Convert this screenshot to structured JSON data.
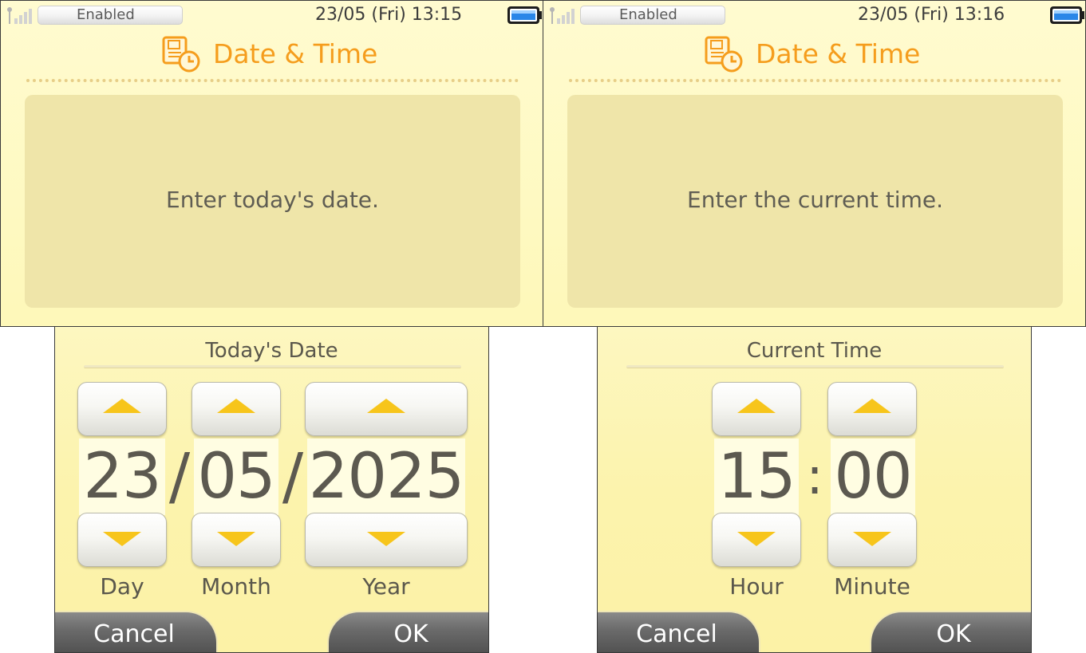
{
  "top_left": {
    "status": {
      "wireless": "Enabled",
      "datetime": "23/05 (Fri)  13:15"
    },
    "title": "Date & Time",
    "message": "Enter today's date."
  },
  "top_right": {
    "status": {
      "wireless": "Enabled",
      "datetime": "23/05 (Fri)  13:16"
    },
    "title": "Date & Time",
    "message": "Enter the current time."
  },
  "date_screen": {
    "title": "Today's Date",
    "fields": {
      "day": {
        "value": "23",
        "label": "Day"
      },
      "month": {
        "value": "05",
        "label": "Month"
      },
      "year": {
        "value": "2025",
        "label": "Year"
      }
    },
    "separator": "/",
    "cancel_label": "Cancel",
    "ok_label": "OK"
  },
  "time_screen": {
    "title": "Current Time",
    "fields": {
      "hour": {
        "value": "15",
        "label": "Hour"
      },
      "minute": {
        "value": "00",
        "label": "Minute"
      }
    },
    "separator": ":",
    "cancel_label": "Cancel",
    "ok_label": "OK"
  },
  "colors": {
    "title_orange": "#f59d1d",
    "arrow_yellow": "#f7c51b",
    "screen_bg": "#fdf7c0",
    "panel_bg": "#efe5a9",
    "button_gray": "#6b6b6b"
  },
  "icons": [
    "wifi-signal-icon",
    "battery-icon",
    "calendar-clock-icon",
    "up-arrow-icon",
    "down-arrow-icon"
  ]
}
